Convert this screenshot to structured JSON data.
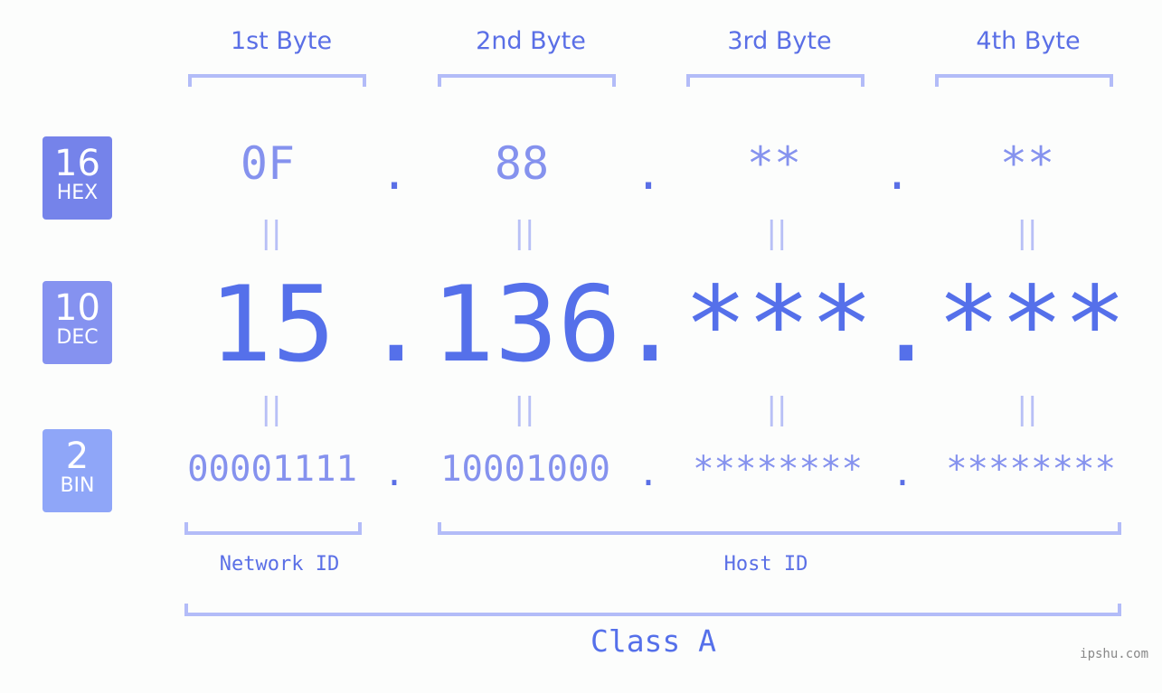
{
  "bytes": {
    "headers": [
      "1st Byte",
      "2nd Byte",
      "3rd Byte",
      "4th Byte"
    ],
    "hex": [
      "0F",
      "88",
      "**",
      "**"
    ],
    "dec": [
      "15",
      "136",
      "***",
      "***"
    ],
    "bin": [
      "00001111",
      "10001000",
      "********",
      "********"
    ],
    "separator": ".",
    "equals": "||"
  },
  "badges": {
    "hex": {
      "number": "16",
      "label": "HEX",
      "color": "#7583ea"
    },
    "dec": {
      "number": "10",
      "label": "DEC",
      "color": "#8592f0"
    },
    "bin": {
      "number": "2",
      "label": "BIN",
      "color": "#8fa6f8"
    }
  },
  "parts": {
    "network": "Network ID",
    "host": "Host ID"
  },
  "class_label": "Class A",
  "watermark": "ipshu.com",
  "colors": {
    "accent": "#5570ea",
    "light": "#8592ee",
    "bracket": "#b3bcf8",
    "background": "#fcfdfc"
  }
}
